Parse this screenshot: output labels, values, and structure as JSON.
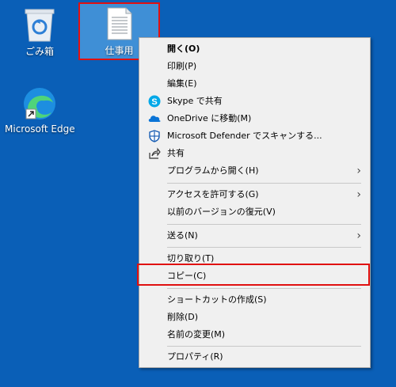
{
  "desktop": {
    "icons": [
      {
        "label": "ごみ箱"
      },
      {
        "label": "仕事用"
      },
      {
        "label": "Microsoft Edge"
      }
    ]
  },
  "context_menu": {
    "items": [
      {
        "label": "開く(O)",
        "icon": "none"
      },
      {
        "label": "印刷(P)",
        "icon": "none"
      },
      {
        "label": "編集(E)",
        "icon": "none"
      },
      {
        "label": "Skype で共有",
        "icon": "skype-icon"
      },
      {
        "label": "OneDrive に移動(M)",
        "icon": "onedrive-icon"
      },
      {
        "label": "Microsoft Defender でスキャンする...",
        "icon": "defender-icon"
      },
      {
        "label": "共有",
        "icon": "share-icon"
      },
      {
        "label": "プログラムから開く(H)",
        "icon": "chevron-right-icon"
      },
      {
        "label": "アクセスを許可する(G)",
        "icon": "chevron-right-icon"
      },
      {
        "label": "以前のバージョンの復元(V)",
        "icon": "none"
      },
      {
        "label": "送る(N)",
        "icon": "chevron-right-icon"
      },
      {
        "label": "切り取り(T)",
        "icon": "none"
      },
      {
        "label": "コピー(C)",
        "icon": "none"
      },
      {
        "label": "ショートカットの作成(S)",
        "icon": "none"
      },
      {
        "label": "削除(D)",
        "icon": "none"
      },
      {
        "label": "名前の変更(M)",
        "icon": "none"
      },
      {
        "label": "プロパティ(R)",
        "icon": "none"
      }
    ]
  },
  "colors": {
    "desktop_bg": "#0a5fb7",
    "highlight_border": "#e01010",
    "menu_bg": "#f0f0f0"
  }
}
